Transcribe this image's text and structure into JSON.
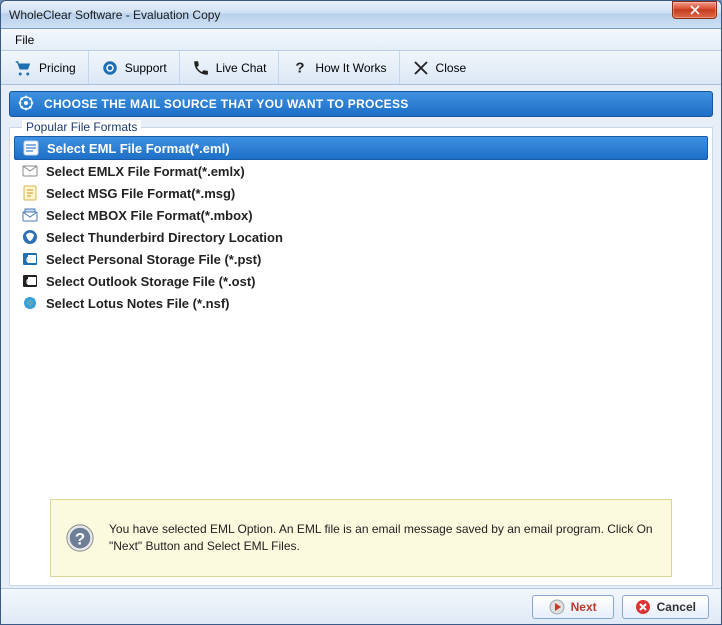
{
  "window": {
    "title": "WholeClear Software - Evaluation Copy"
  },
  "menubar": {
    "file": "File"
  },
  "toolbar": {
    "pricing": "Pricing",
    "support": "Support",
    "livechat": "Live Chat",
    "howitworks": "How It Works",
    "close": "Close"
  },
  "heading": "CHOOSE THE MAIL SOURCE THAT YOU WANT TO PROCESS",
  "group_label": "Popular File Formats",
  "options": [
    {
      "id": "eml",
      "label": "Select EML File Format(*.eml)",
      "selected": true
    },
    {
      "id": "emlx",
      "label": "Select EMLX File Format(*.emlx)",
      "selected": false
    },
    {
      "id": "msg",
      "label": "Select MSG File Format(*.msg)",
      "selected": false
    },
    {
      "id": "mbox",
      "label": "Select MBOX File Format(*.mbox)",
      "selected": false
    },
    {
      "id": "tbird",
      "label": "Select Thunderbird Directory Location",
      "selected": false
    },
    {
      "id": "pst",
      "label": "Select Personal Storage File (*.pst)",
      "selected": false
    },
    {
      "id": "ost",
      "label": "Select Outlook Storage File (*.ost)",
      "selected": false
    },
    {
      "id": "nsf",
      "label": "Select Lotus Notes File (*.nsf)",
      "selected": false
    }
  ],
  "info_text": "You have selected EML Option. An EML file is an email message saved by an email program. Click On \"Next\" Button and Select EML Files.",
  "buttons": {
    "next": "Next",
    "cancel": "Cancel"
  },
  "icons": {
    "pricing": "cart-icon",
    "support": "headset-icon",
    "livechat": "phone-icon",
    "howitworks": "question-icon",
    "close": "scissors-icon",
    "heading": "gear-icon",
    "info": "question-circle-icon",
    "next": "play-circle-icon",
    "cancel": "cancel-circle-icon"
  }
}
